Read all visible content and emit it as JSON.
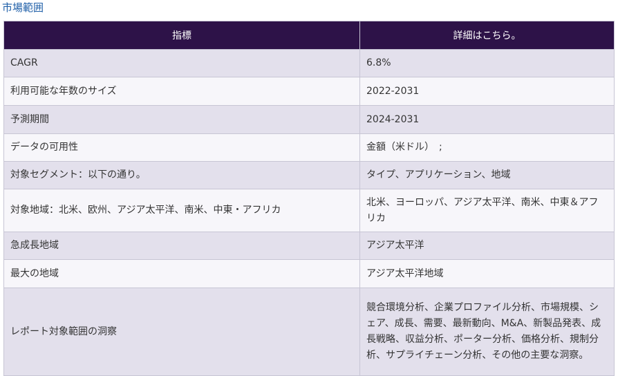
{
  "section": {
    "title": "市場範囲"
  },
  "table": {
    "headers": [
      "指標",
      "詳細はこちら。"
    ],
    "rows": [
      {
        "metric": "CAGR",
        "detail": "6.8%"
      },
      {
        "metric": "利用可能な年数のサイズ",
        "detail": "2022-2031"
      },
      {
        "metric": "予測期間",
        "detail": "2024-2031"
      },
      {
        "metric": "データの可用性",
        "detail": "金額（米ドル）　;"
      },
      {
        "metric": "対象セグメント：以下の通り。",
        "detail": "タイプ、アプリケーション、地域"
      },
      {
        "metric": "対象地域：北米、欧州、アジア太平洋、南米、中東・アフリカ",
        "detail": "北米、ヨーロッパ、アジア太平洋、南米、中東＆アフリカ"
      },
      {
        "metric": "急成長地域",
        "detail": "アジア太平洋"
      },
      {
        "metric": "最大の地域",
        "detail": "アジア太平洋地域"
      },
      {
        "metric": "レポート対象範囲の洞察",
        "detail": "競合環境分析、企業プロファイル分析、市場規模、シェア、成長、需要、最新動向、M&A、新製品発表、成長戦略、収益分析、ポーター分析、価格分析、規制分析、サプライチェーン分析、その他の主要な洞察。"
      }
    ]
  },
  "colors": {
    "header_bg": "#2d1248",
    "title_color": "#1f5fa8",
    "row_odd": "#e3e0ec",
    "row_even": "#f7f6fa"
  }
}
